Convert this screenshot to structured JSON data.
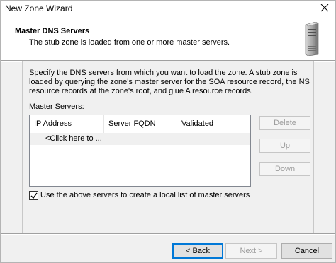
{
  "window": {
    "title": "New Zone Wizard"
  },
  "header": {
    "title": "Master DNS Servers",
    "subtitle": "The stub zone is loaded from one or more master servers."
  },
  "body": {
    "description": "Specify the DNS servers from which you want to load the zone. A stub zone is loaded by querying the zone's master server for the SOA resource record, the NS resource records at the zone's root, and glue A resource records.",
    "servers_label": "Master Servers:"
  },
  "list": {
    "columns": [
      "IP Address",
      "Server FQDN",
      "Validated"
    ],
    "rows": [
      {
        "ip": "<Click here to ...",
        "fqdn": "",
        "validated": ""
      }
    ]
  },
  "side_buttons": {
    "delete": "Delete",
    "up": "Up",
    "down": "Down"
  },
  "checkbox": {
    "label": "Use the above servers to create a local list of master servers",
    "checked": true
  },
  "footer": {
    "back": "< Back",
    "next": "Next >",
    "cancel": "Cancel"
  }
}
